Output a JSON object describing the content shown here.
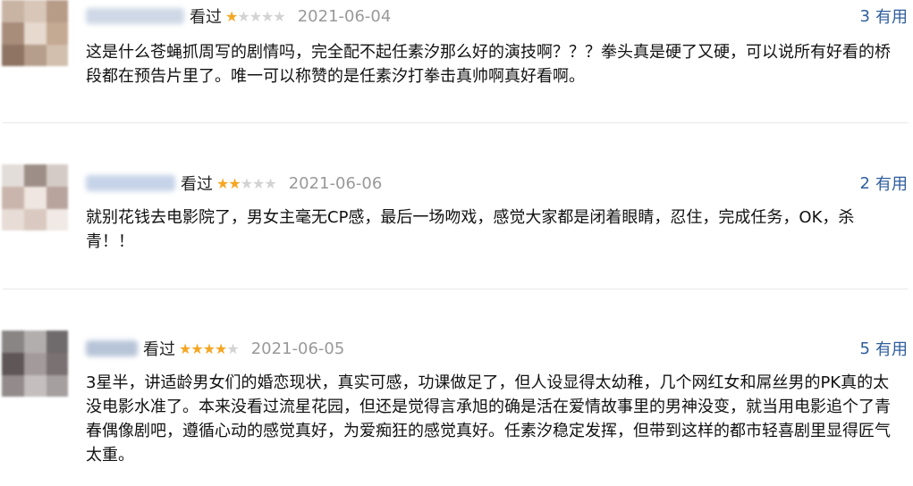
{
  "reviews": [
    {
      "status": "看过",
      "rating": 1,
      "date": "2021-06-04",
      "useful_count": "3",
      "useful_label": "有用",
      "content": "这是什么苍蝇抓周写的剧情吗，完全配不起任素汐那么好的演技啊？？？拳头真是硬了又硬，可以说所有好看的桥段都在预告片里了。唯一可以称赞的是任素汐打拳击真帅啊真好看啊。"
    },
    {
      "status": "看过",
      "rating": 2,
      "date": "2021-06-06",
      "useful_count": "2",
      "useful_label": "有用",
      "content": "就别花钱去电影院了，男女主毫无CP感，最后一场吻戏，感觉大家都是闭着眼睛，忍住，完成任务，OK，杀青！！"
    },
    {
      "status": "看过",
      "rating": 4,
      "date": "2021-06-05",
      "useful_count": "5",
      "useful_label": "有用",
      "content": "3星半，讲适龄男女们的婚恋现状，真实可感，功课做足了，但人设显得太幼稚，几个网红女和屌丝男的PK真的太没电影水准了。本来没看过流星花园，但还是觉得言承旭的确是活在爱情故事里的男神没变，就当用电影追个了青春偶像剧吧，遵循心动的感觉真好，为爱痴狂的感觉真好。任素汐稳定发挥，但带到这样的都市轻喜剧里显得匠气太重。"
    }
  ],
  "colors": {
    "link": "#2f5d9d",
    "star_on": "#f5a623",
    "star_off": "#d3d3d3",
    "date": "#999999"
  }
}
